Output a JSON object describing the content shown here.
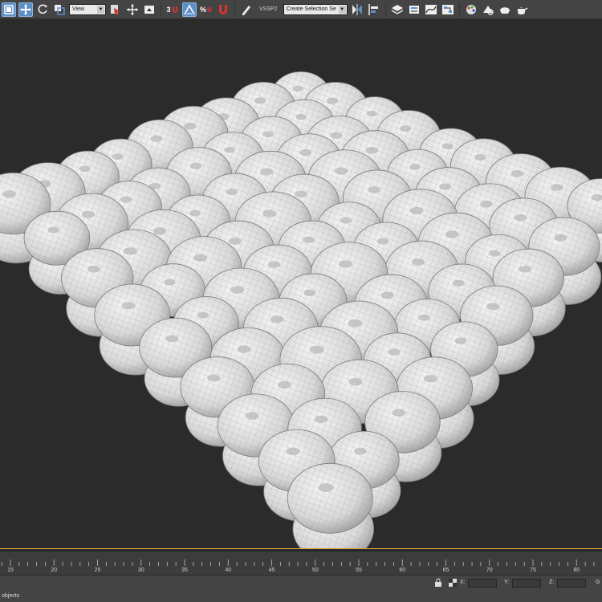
{
  "toolbar": {
    "view_dropdown": "View",
    "snap_label": "3",
    "percent_label": "%",
    "named_set_label": "VSSP2",
    "selection_set_dropdown": "Create Selection Se",
    "icons": [
      "select-object-icon",
      "select-move-icon",
      "rotate-icon",
      "scale-icon",
      "reference-coord-dropdown",
      "pivot-icon",
      "move-gizmo-icon",
      "keyboard-icon",
      "snap-toggle-icon",
      "angle-snap-icon",
      "percent-snap-icon",
      "spinner-snap-icon",
      "edit-named-sets-icon",
      "mirror-icon",
      "align-icon",
      "layer-icon",
      "scene-explorer-icon",
      "curve-editor-icon",
      "schematic-icon",
      "material-editor-icon",
      "render-setup-icon",
      "render-frame-icon",
      "render-icon",
      "teapot-icon"
    ],
    "accent_color": "#5d8fc7"
  },
  "viewport": {
    "background_color": "#2b2b2b",
    "active_border_color": "#e0a33a",
    "mesh_color": "#e8e8e8",
    "wire_color": "#9a9a9a"
  },
  "timeline": {
    "ticks": [
      15,
      20,
      25,
      30,
      35,
      40,
      45,
      50,
      55,
      60,
      65,
      70,
      75,
      80
    ]
  },
  "status": {
    "selection_text": "objects",
    "x_label": "X:",
    "y_label": "Y:",
    "z_label": "Z:",
    "grid_label": "G"
  }
}
